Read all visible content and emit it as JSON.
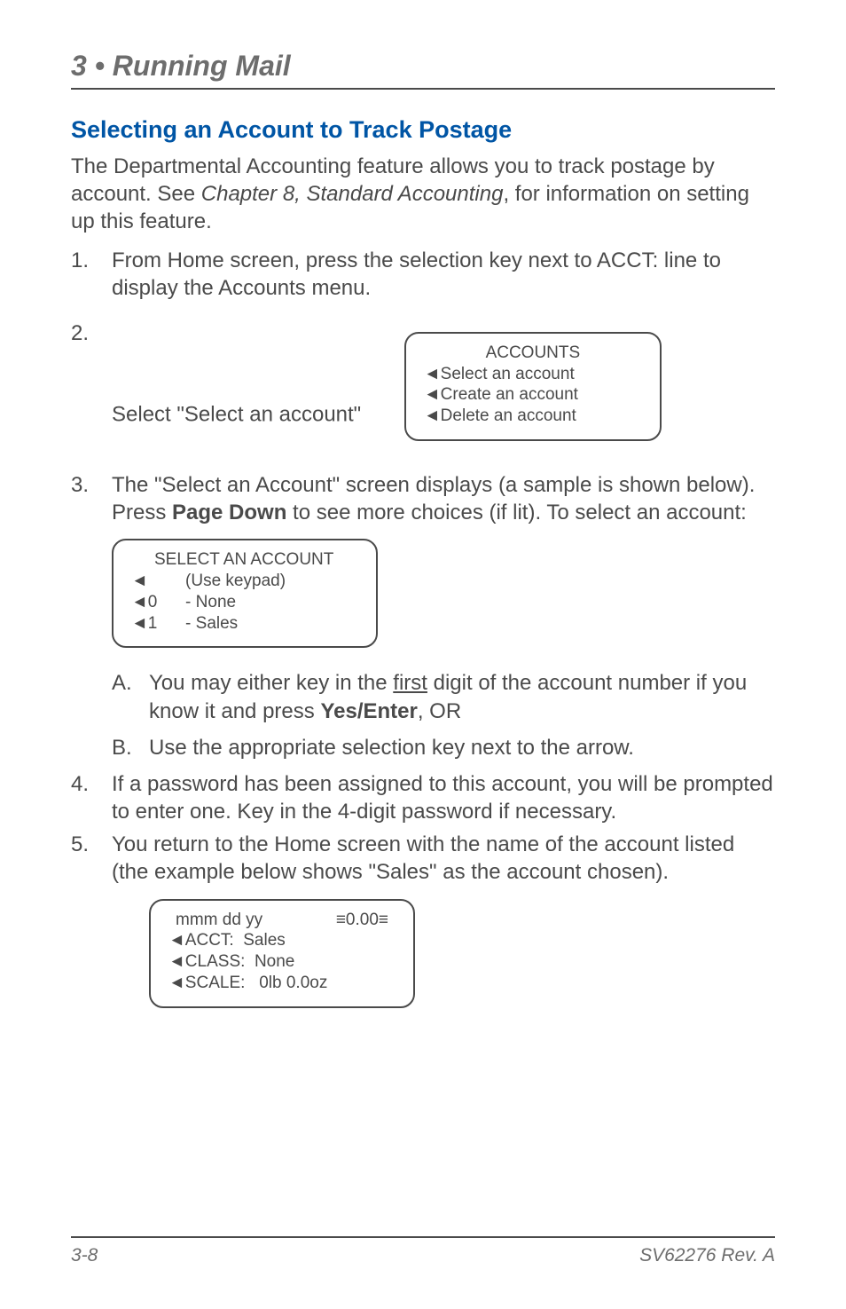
{
  "header": {
    "chapter": "3 • Running Mail"
  },
  "section": {
    "title": "Selecting an Account to Track Postage"
  },
  "intro": {
    "pre": "The Departmental Accounting feature allows you to track postage by account. See ",
    "italic": "Chapter 8, Standard Accounting",
    "post": ", for information on setting up this feature."
  },
  "steps": {
    "1": {
      "num": "1.",
      "text": "From Home screen, press the selection key next to ACCT: line to display the Accounts menu."
    },
    "2": {
      "num": "2.",
      "text": "Select \"Select an account\""
    },
    "3": {
      "num": "3.",
      "pre": "The \"Select an Account\" screen displays (a sample is shown below). Press ",
      "bold": "Page Down",
      "post": " to see more choices (if lit). To select an account:"
    },
    "3A": {
      "letter": "A.",
      "pre": "You may either key in the ",
      "under": "first",
      "mid": " digit of the account number if you know it and press ",
      "bold": "Yes/Enter",
      "post": ",  OR"
    },
    "3B": {
      "letter": "B.",
      "text": "Use the appropriate selection key next to the arrow."
    },
    "4": {
      "num": "4.",
      "text": "If a password has been assigned to this account, you will be prompted to enter one. Key in the 4-digit password if necessary."
    },
    "5": {
      "num": "5.",
      "text": "You return to the Home screen with the name of the account listed (the example below shows \"Sales\" as the account chosen)."
    }
  },
  "lcd1": {
    "title": "ACCOUNTS",
    "row1": "◄Select an account",
    "row2": "◄Create an account",
    "row3": "◄Delete an account"
  },
  "lcd2": {
    "title": "SELECT AN ACCOUNT",
    "row1": "◄        (Use keypad)",
    "row2": "◄0      - None",
    "row3": "◄1      - Sales"
  },
  "lcd3": {
    "date": "mmm dd yy",
    "amount": "≡0.00≡",
    "row1": "◄ACCT:  Sales",
    "row2": "◄CLASS:  None",
    "row3": "◄SCALE:   0lb 0.0oz"
  },
  "footer": {
    "page": "3-8",
    "doc": "SV62276 Rev. A"
  }
}
